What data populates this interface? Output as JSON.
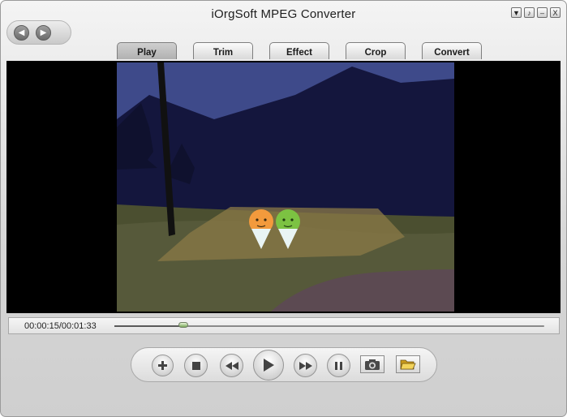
{
  "window": {
    "title": "iOrgSoft MPEG Converter"
  },
  "window_controls": {
    "menu": "▼",
    "skin": "♪",
    "minimize": "–",
    "close": "X"
  },
  "tabs": [
    {
      "label": "Play",
      "active": true
    },
    {
      "label": "Trim",
      "active": false
    },
    {
      "label": "Effect",
      "active": false
    },
    {
      "label": "Crop",
      "active": false
    },
    {
      "label": "Convert",
      "active": false
    }
  ],
  "player": {
    "time_display": "00:00:15/00:01:33",
    "progress_fraction": 0.161
  },
  "controls": {
    "buttons": [
      "add-icon",
      "stop-icon",
      "rewind-icon",
      "play-icon",
      "fast-forward-icon",
      "pause-icon",
      "snapshot-camera-icon",
      "open-folder-icon"
    ]
  },
  "colors": {
    "video_background": "#000000",
    "accent_thumb": "#7aa85a"
  }
}
